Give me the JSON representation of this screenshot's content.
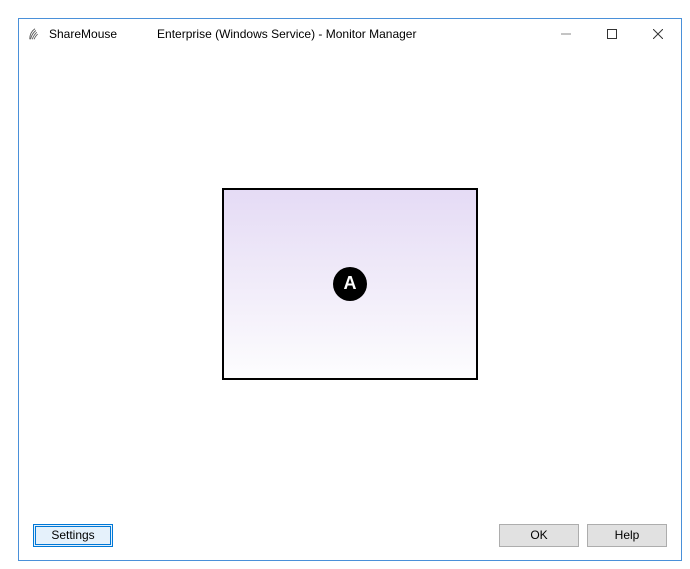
{
  "titlebar": {
    "app_name": "ShareMouse",
    "subtitle": "Enterprise (Windows Service) - Monitor Manager"
  },
  "monitor": {
    "label": "A"
  },
  "footer": {
    "settings_label": "Settings",
    "ok_label": "OK",
    "help_label": "Help"
  }
}
